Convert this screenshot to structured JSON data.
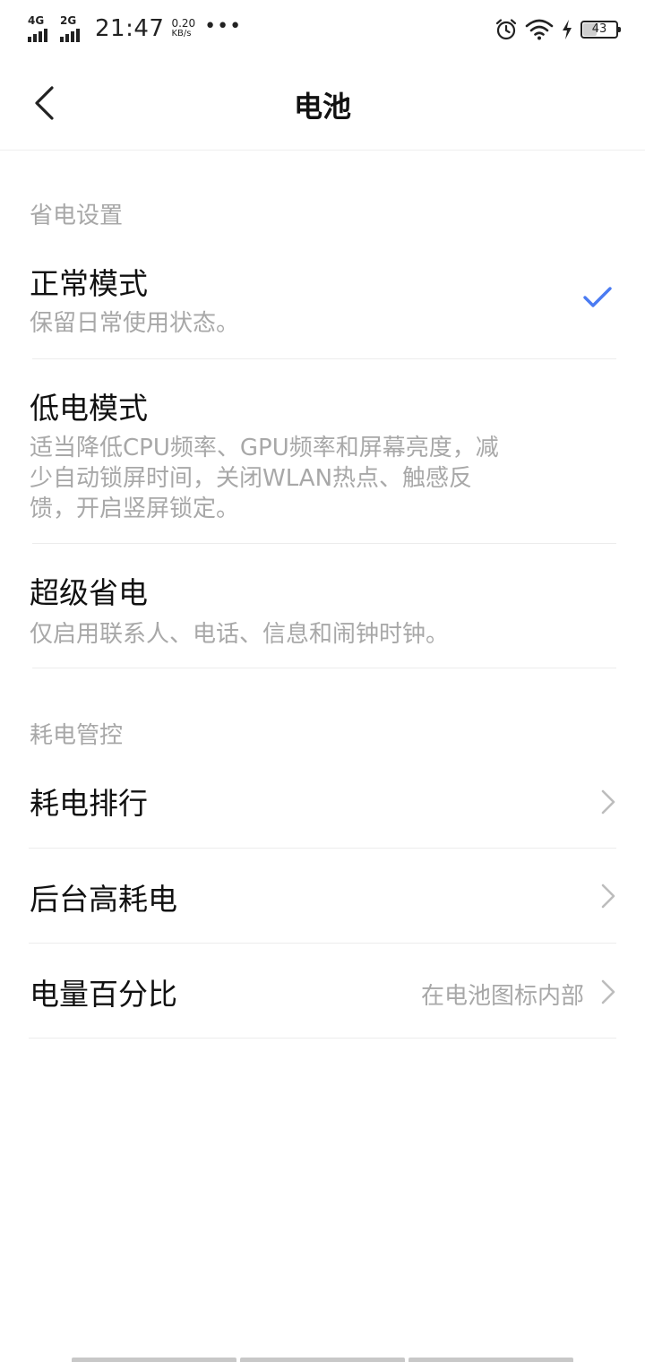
{
  "status_bar": {
    "net1": "4G",
    "net2": "2G",
    "time": "21:47",
    "speed_value": "0.20",
    "speed_unit": "KB/s",
    "more": "•••",
    "battery_level": "43",
    "battery_fraction": 0.43
  },
  "header": {
    "title": "电池"
  },
  "power_saving": {
    "section_label": "省电设置",
    "options": [
      {
        "title": "正常模式",
        "desc": "保留日常使用状态。",
        "selected": true
      },
      {
        "title": "低电模式",
        "desc_lines": [
          "适当降低CPU频率、GPU频率和屏幕亮度，减",
          "少自动锁屏时间，关闭WLAN热点、触感反",
          "馈，开启竖屏锁定。"
        ],
        "selected": false
      },
      {
        "title": "超级省电",
        "desc": "仅启用联系人、电话、信息和闹钟时钟。",
        "selected": false
      }
    ]
  },
  "consumption": {
    "section_label": "耗电管控",
    "rows": [
      {
        "title": "耗电排行",
        "value": ""
      },
      {
        "title": "后台高耗电",
        "value": ""
      },
      {
        "title": "电量百分比",
        "value": "在电池图标内部"
      }
    ]
  },
  "colors": {
    "accent": "#4a7bf2",
    "secondary_text": "#a8a8a8",
    "divider": "#ececec"
  }
}
